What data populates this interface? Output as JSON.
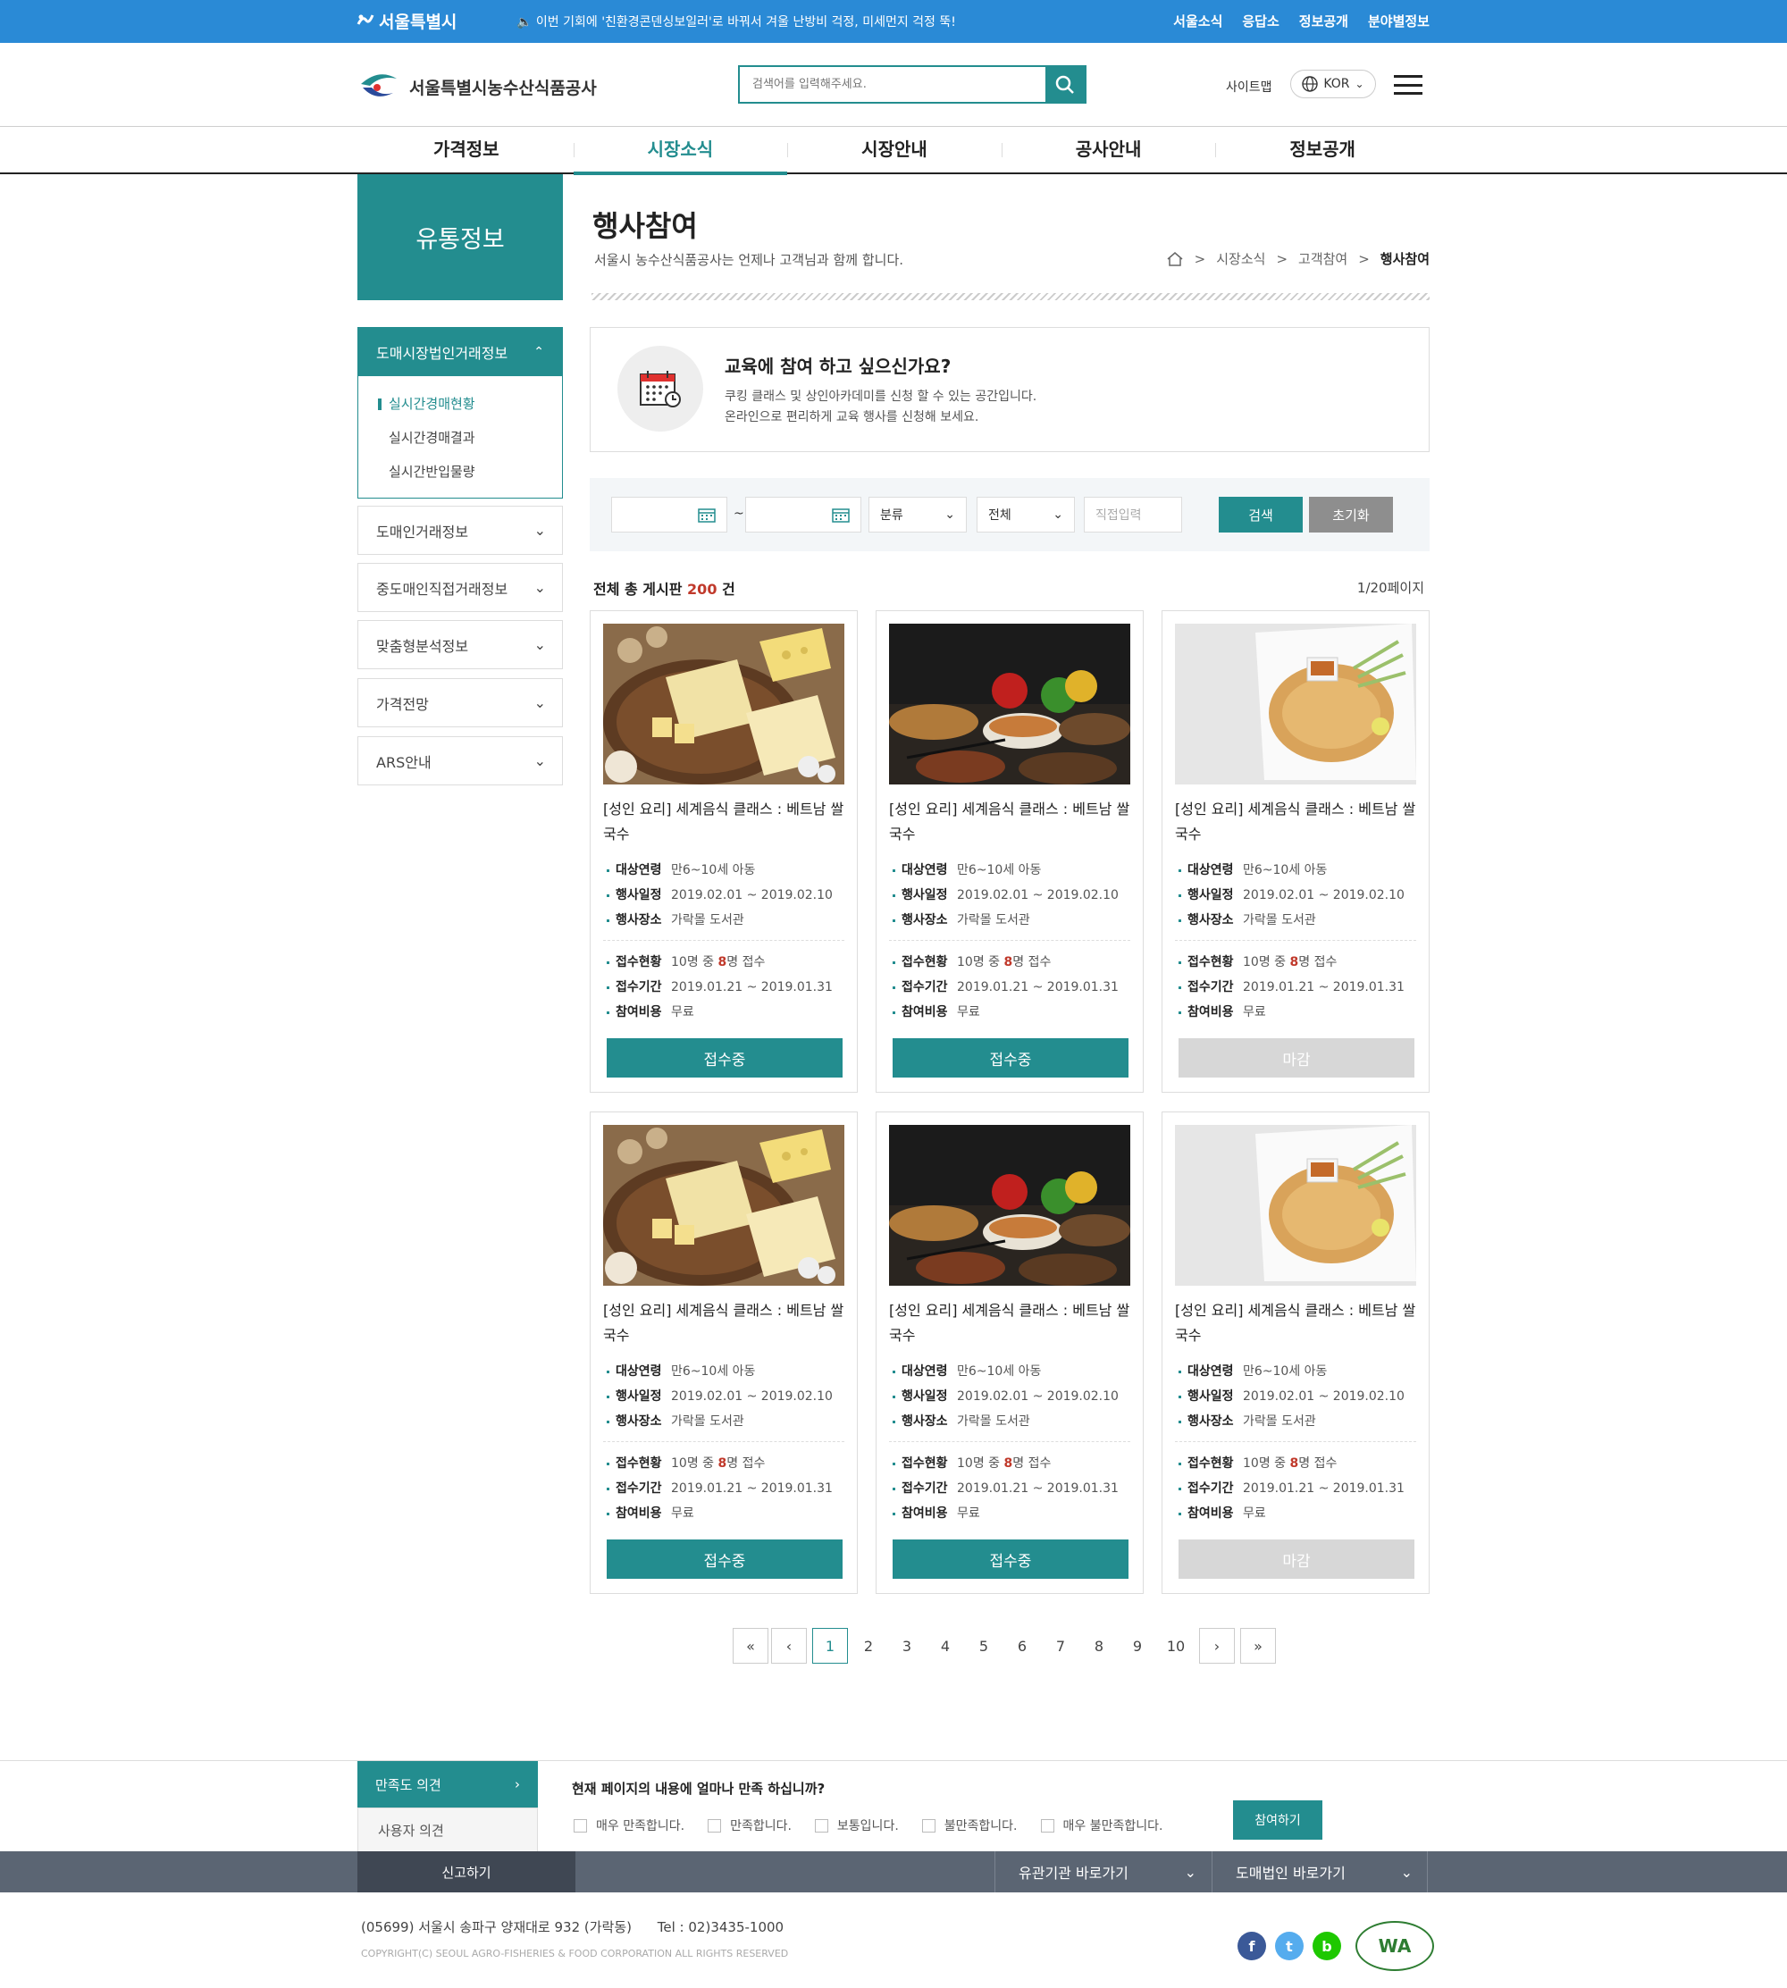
{
  "topbar": {
    "city": "서울특별시",
    "notice": "이번 기회에 '친환경콘덴싱보일러'로 바꿔서 겨울 난방비 걱정, 미세먼지 걱정 뚝!",
    "links": [
      "서울소식",
      "응답소",
      "정보공개",
      "분야별정보"
    ]
  },
  "header": {
    "org": "서울특별시농수산식품공사",
    "search_placeholder": "검색어를 입력해주세요.",
    "sitemap": "사이트맵",
    "lang": "KOR"
  },
  "gnb": [
    "가격정보",
    "시장소식",
    "시장안내",
    "공사안내",
    "정보공개"
  ],
  "lnb": {
    "title": "유통정보",
    "open": {
      "label": "도매시장법인거래정보",
      "items": [
        "실시간경매현황",
        "실시간경매결과",
        "실시간반입물량"
      ]
    },
    "items": [
      "도매인거래정보",
      "중도매인직접거래정보",
      "맞춤형분석정보",
      "가격전망",
      "ARS안내"
    ]
  },
  "page": {
    "title": "행사참여",
    "subtitle": "서울시 농수산식품공사는 언제나 고객님과 함께 합니다.",
    "breadcrumb": [
      "시장소식",
      "고객참여",
      "행사참여"
    ]
  },
  "info": {
    "question": "교육에 참여 하고 싶으신가요?",
    "desc1": "쿠킹 클래스 및 상인아카데미를 신청 할 수 있는 공간입니다.",
    "desc2": "온라인으로 편리하게 교육 행사를 신청해 보세요."
  },
  "filter": {
    "tilde": "~",
    "category": "분류",
    "scope": "전체",
    "direct_placeholder": "직접입력",
    "search": "검색",
    "reset": "초기화"
  },
  "list": {
    "total_prefix": "전체 총 게시판",
    "total_count": "200",
    "total_suffix": "건",
    "page_info": "1/20페이지"
  },
  "labels": {
    "age": "대상연령",
    "date": "행사일정",
    "place": "행사장소",
    "status": "접수현황",
    "period": "접수기간",
    "fee": "참여비용"
  },
  "cards": [
    {
      "title": "[성인 요리] 세계음식 클래스 : 베트남 쌀국수",
      "age": "만6~10세 아동",
      "date": "2019.02.01 ~ 2019.02.10",
      "place": "가락몰 도서관",
      "status_a": "10명 중 ",
      "status_n": "8",
      "status_b": "명 접수",
      "period": "2019.01.21 ~ 2019.01.31",
      "fee": "무료",
      "button": "접수중",
      "image": "cheese-board"
    },
    {
      "title": "[성인 요리] 세계음식 클래스 : 베트남 쌀국수",
      "age": "만6~10세 아동",
      "date": "2019.02.01 ~ 2019.02.10",
      "place": "가락몰 도서관",
      "status_a": "10명 중 ",
      "status_n": "8",
      "status_b": "명 접수",
      "period": "2019.01.21 ~ 2019.01.31",
      "fee": "무료",
      "button": "접수중",
      "image": "asian-dishes"
    },
    {
      "title": "[성인 요리] 세계음식 클래스 : 베트남 쌀국수",
      "age": "만6~10세 아동",
      "date": "2019.02.01 ~ 2019.02.10",
      "place": "가락몰 도서관",
      "status_a": "10명 중 ",
      "status_n": "8",
      "status_b": "명 접수",
      "period": "2019.01.21 ~ 2019.01.31",
      "fee": "무료",
      "button": "마감",
      "image": "pad-thai-plate"
    },
    {
      "title": "[성인 요리] 세계음식 클래스 : 베트남 쌀국수",
      "age": "만6~10세 아동",
      "date": "2019.02.01 ~ 2019.02.10",
      "place": "가락몰 도서관",
      "status_a": "10명 중 ",
      "status_n": "8",
      "status_b": "명 접수",
      "period": "2019.01.21 ~ 2019.01.31",
      "fee": "무료",
      "button": "접수중",
      "image": "cheese-board"
    },
    {
      "title": "[성인 요리] 세계음식 클래스 : 베트남 쌀국수",
      "age": "만6~10세 아동",
      "date": "2019.02.01 ~ 2019.02.10",
      "place": "가락몰 도서관",
      "status_a": "10명 중 ",
      "status_n": "8",
      "status_b": "명 접수",
      "period": "2019.01.21 ~ 2019.01.31",
      "fee": "무료",
      "button": "접수중",
      "image": "asian-dishes"
    },
    {
      "title": "[성인 요리] 세계음식 클래스 : 베트남 쌀국수",
      "age": "만6~10세 아동",
      "date": "2019.02.01 ~ 2019.02.10",
      "place": "가락몰 도서관",
      "status_a": "10명 중 ",
      "status_n": "8",
      "status_b": "명 접수",
      "period": "2019.01.21 ~ 2019.01.31",
      "fee": "무료",
      "button": "마감",
      "image": "pad-thai-plate"
    }
  ],
  "pagination": [
    "1",
    "2",
    "3",
    "4",
    "5",
    "6",
    "7",
    "8",
    "9",
    "10"
  ],
  "survey": {
    "tab_satisfaction": "만족도 의견",
    "tab_user": "사용자 의견",
    "question": "현재 페이지의 내용에 얼마나 만족 하십니까?",
    "options": [
      "매우 만족합니다.",
      "만족합니다.",
      "보통입니다.",
      "불만족합니다.",
      "매우 불만족합니다."
    ],
    "submit": "참여하기"
  },
  "footer": {
    "report": "신고하기",
    "related": "유관기관 바로가기",
    "wholesale": "도매법인 바로가기",
    "address": "(05699) 서울시 송파구 양재대로 932 (가락동)",
    "tel": "Tel : 02)3435-1000",
    "copyright": "COPYRIGHT(C) SEOUL AGRO-FISHERIES & FOOD CORPORATION ALL RIGHTS RESERVED",
    "wa": "WA"
  },
  "colors": {
    "primary": "#238d8f",
    "topbar": "#2a8ad6",
    "accent_red": "#c0392b",
    "footer_bar": "#5b6573"
  }
}
